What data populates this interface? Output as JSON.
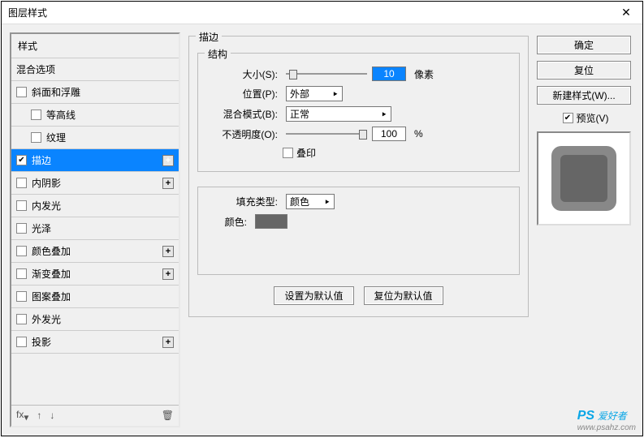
{
  "window": {
    "title": "图层样式"
  },
  "styles_panel": {
    "header": "样式",
    "blend_options": "混合选项",
    "items": [
      {
        "label": "斜面和浮雕",
        "checked": false,
        "indent": 0,
        "plus": false
      },
      {
        "label": "等高线",
        "checked": false,
        "indent": 1,
        "plus": false
      },
      {
        "label": "纹理",
        "checked": false,
        "indent": 1,
        "plus": false
      },
      {
        "label": "描边",
        "checked": true,
        "indent": 0,
        "plus": true,
        "selected": true
      },
      {
        "label": "内阴影",
        "checked": false,
        "indent": 0,
        "plus": true
      },
      {
        "label": "内发光",
        "checked": false,
        "indent": 0,
        "plus": false
      },
      {
        "label": "光泽",
        "checked": false,
        "indent": 0,
        "plus": false
      },
      {
        "label": "颜色叠加",
        "checked": false,
        "indent": 0,
        "plus": true
      },
      {
        "label": "渐变叠加",
        "checked": false,
        "indent": 0,
        "plus": true
      },
      {
        "label": "图案叠加",
        "checked": false,
        "indent": 0,
        "plus": false
      },
      {
        "label": "外发光",
        "checked": false,
        "indent": 0,
        "plus": false
      },
      {
        "label": "投影",
        "checked": false,
        "indent": 0,
        "plus": true
      }
    ]
  },
  "stroke": {
    "group_title": "描边",
    "structure_title": "结构",
    "size_label": "大小(S):",
    "size_value": "10",
    "size_unit": "像素",
    "position_label": "位置(P):",
    "position_value": "外部",
    "blend_label": "混合模式(B):",
    "blend_value": "正常",
    "opacity_label": "不透明度(O):",
    "opacity_value": "100",
    "opacity_unit": "%",
    "overprint_label": "叠印",
    "fill_type_label": "填充类型:",
    "fill_type_value": "颜色",
    "color_label": "颜色:",
    "color_value": "#666666",
    "set_default": "设置为默认值",
    "reset_default": "复位为默认值"
  },
  "right": {
    "ok": "确定",
    "cancel": "复位",
    "new_style": "新建样式(W)...",
    "preview_label": "预览(V)"
  },
  "watermark": {
    "brand": "PS",
    "text": "爱好者",
    "url": "www.psahz.com"
  }
}
